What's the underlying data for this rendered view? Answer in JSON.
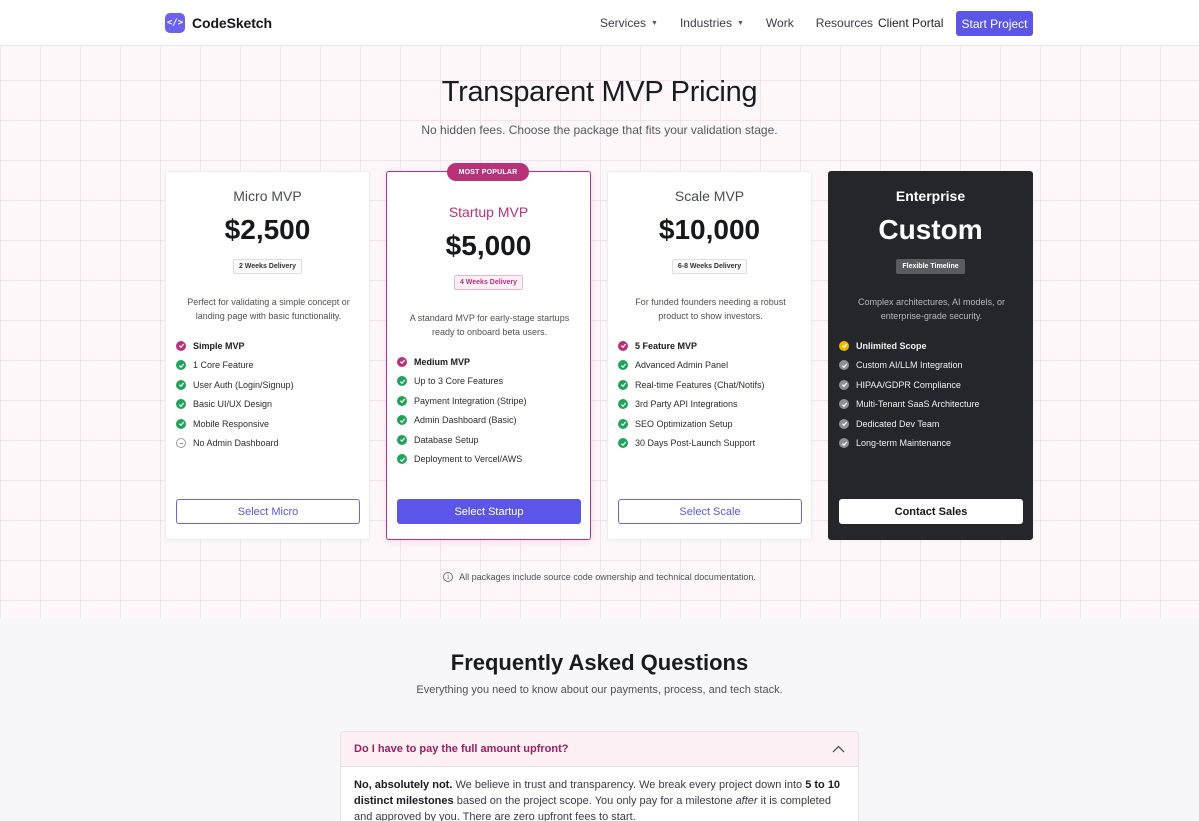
{
  "header": {
    "brand_name": "CodeSketch",
    "logo_glyph": "</>",
    "nav": [
      {
        "label": "Services",
        "has_dropdown": true
      },
      {
        "label": "Industries",
        "has_dropdown": true
      },
      {
        "label": "Work",
        "has_dropdown": false
      },
      {
        "label": "Resources",
        "has_dropdown": false
      }
    ],
    "client_portal": "Client Portal",
    "cta": "Start Project"
  },
  "hero": {
    "title": "Transparent MVP Pricing",
    "subtitle": "No hidden fees. Choose the package that fits your validation stage."
  },
  "plans": [
    {
      "name": "Micro MVP",
      "price": "$2,500",
      "delivery": "2 Weeks Delivery",
      "description": "Perfect for validating a simple concept or landing page with basic functionality.",
      "features": [
        {
          "text": "Simple MVP",
          "icon": "check-circle-icon",
          "bold": true,
          "color": "#b8327a"
        },
        {
          "text": "1 Core Feature",
          "icon": "check-circle-icon",
          "bold": false,
          "color": "#22a35a"
        },
        {
          "text": "User Auth (Login/Signup)",
          "icon": "check-circle-icon",
          "bold": false,
          "color": "#22a35a"
        },
        {
          "text": "Basic UI/UX Design",
          "icon": "check-circle-icon",
          "bold": false,
          "color": "#22a35a"
        },
        {
          "text": "Mobile Responsive",
          "icon": "check-circle-icon",
          "bold": false,
          "color": "#22a35a"
        },
        {
          "text": "No Admin Dashboard",
          "icon": "minus-circle-icon",
          "bold": false,
          "color": "#9a9ba2"
        }
      ],
      "button": "Select Micro"
    },
    {
      "name": "Startup MVP",
      "price": "$5,000",
      "badge": "MOST POPULAR",
      "delivery": "4 Weeks Delivery",
      "description": "A standard MVP for early-stage startups ready to onboard beta users.",
      "features": [
        {
          "text": "Medium MVP",
          "icon": "check-circle-icon",
          "bold": true,
          "color": "#b8327a"
        },
        {
          "text": "Up to 3 Core Features",
          "icon": "check-circle-icon",
          "bold": false,
          "color": "#22a35a"
        },
        {
          "text": "Payment Integration (Stripe)",
          "icon": "check-circle-icon",
          "bold": false,
          "color": "#22a35a"
        },
        {
          "text": "Admin Dashboard (Basic)",
          "icon": "check-circle-icon",
          "bold": false,
          "color": "#22a35a"
        },
        {
          "text": "Database Setup",
          "icon": "check-circle-icon",
          "bold": false,
          "color": "#22a35a"
        },
        {
          "text": "Deployment to Vercel/AWS",
          "icon": "check-circle-icon",
          "bold": false,
          "color": "#22a35a"
        }
      ],
      "button": "Select Startup"
    },
    {
      "name": "Scale MVP",
      "price": "$10,000",
      "delivery": "6-8 Weeks Delivery",
      "description": "For funded founders needing a robust product to show investors.",
      "features": [
        {
          "text": "5 Feature MVP",
          "icon": "check-circle-icon",
          "bold": true,
          "color": "#b8327a"
        },
        {
          "text": "Advanced Admin Panel",
          "icon": "check-circle-icon",
          "bold": false,
          "color": "#22a35a"
        },
        {
          "text": "Real-time Features (Chat/Notifs)",
          "icon": "check-circle-icon",
          "bold": false,
          "color": "#22a35a"
        },
        {
          "text": "3rd Party API Integrations",
          "icon": "check-circle-icon",
          "bold": false,
          "color": "#22a35a"
        },
        {
          "text": "SEO Optimization Setup",
          "icon": "check-circle-icon",
          "bold": false,
          "color": "#22a35a"
        },
        {
          "text": "30 Days Post-Launch Support",
          "icon": "check-circle-icon",
          "bold": false,
          "color": "#22a35a"
        }
      ],
      "button": "Select Scale"
    },
    {
      "name": "Enterprise",
      "price": "Custom",
      "delivery": "Flexible Timeline",
      "description": "Complex architectures, AI models, or enterprise-grade security.",
      "features": [
        {
          "text": "Unlimited Scope",
          "icon": "check-circle-icon",
          "bold": true,
          "color": "#f2b600"
        },
        {
          "text": "Custom AI/LLM Integration",
          "icon": "check-circle-icon",
          "bold": false,
          "color": "#8e8f96"
        },
        {
          "text": "HIPAA/GDPR Compliance",
          "icon": "check-circle-icon",
          "bold": false,
          "color": "#8e8f96"
        },
        {
          "text": "Multi-Tenant SaaS Architecture",
          "icon": "check-circle-icon",
          "bold": false,
          "color": "#8e8f96"
        },
        {
          "text": "Dedicated Dev Team",
          "icon": "check-circle-icon",
          "bold": false,
          "color": "#8e8f96"
        },
        {
          "text": "Long-term Maintenance",
          "icon": "check-circle-icon",
          "bold": false,
          "color": "#8e8f96"
        }
      ],
      "button": "Contact Sales"
    }
  ],
  "note": {
    "icon": "info-icon",
    "text": "All packages include source code ownership and technical documentation."
  },
  "faq": {
    "title": "Frequently Asked Questions",
    "subtitle": "Everything you need to know about our payments, process, and tech stack.",
    "items": [
      {
        "question": "Do I have to pay the full amount upfront?",
        "expanded": true,
        "answer_parts": [
          {
            "text": "No, absolutely not.",
            "style": "bold"
          },
          {
            "text": " We believe in trust and transparency. We break every project down into ",
            "style": "normal"
          },
          {
            "text": "5 to 10 distinct milestones",
            "style": "bold"
          },
          {
            "text": " based on the project scope. You only pay for a milestone ",
            "style": "normal"
          },
          {
            "text": "after",
            "style": "italic"
          },
          {
            "text": " it is completed and approved by you. There are zero upfront fees to start.",
            "style": "normal"
          }
        ]
      }
    ]
  },
  "colors": {
    "accent": "#5b55e8",
    "brand_pink": "#b8327a",
    "check_green": "#22a35a",
    "dark_card": "#25262b",
    "gold": "#f2b600"
  }
}
